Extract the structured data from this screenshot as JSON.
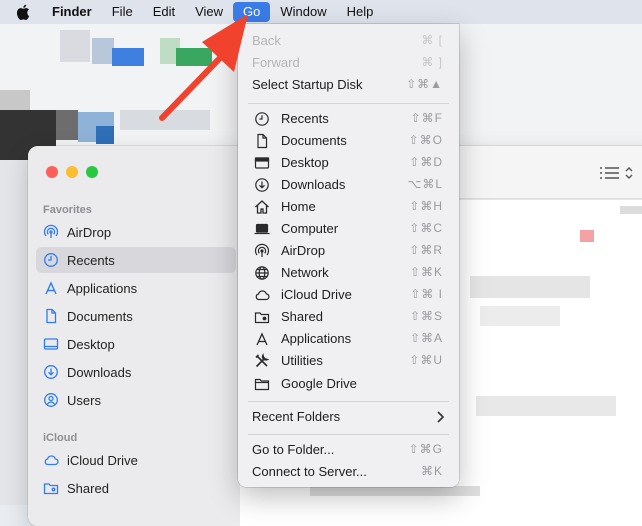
{
  "menubar": {
    "items": [
      {
        "label": "Finder"
      },
      {
        "label": "File"
      },
      {
        "label": "Edit"
      },
      {
        "label": "View"
      },
      {
        "label": "Go"
      },
      {
        "label": "Window"
      },
      {
        "label": "Help"
      }
    ]
  },
  "go_menu": {
    "nav": [
      {
        "label": "Back",
        "shortcut": "⌘ [",
        "disabled": true
      },
      {
        "label": "Forward",
        "shortcut": "⌘ ]",
        "disabled": true
      },
      {
        "label": "Select Startup Disk",
        "shortcut": "⇧⌘▲"
      }
    ],
    "places": [
      {
        "label": "Recents",
        "shortcut": "⇧⌘F",
        "icon": "clock-icon"
      },
      {
        "label": "Documents",
        "shortcut": "⇧⌘O",
        "icon": "document-icon"
      },
      {
        "label": "Desktop",
        "shortcut": "⇧⌘D",
        "icon": "desktop-icon"
      },
      {
        "label": "Downloads",
        "shortcut": "⌥⌘L",
        "icon": "download-icon"
      },
      {
        "label": "Home",
        "shortcut": "⇧⌘H",
        "icon": "home-icon"
      },
      {
        "label": "Computer",
        "shortcut": "⇧⌘C",
        "icon": "laptop-icon"
      },
      {
        "label": "AirDrop",
        "shortcut": "⇧⌘R",
        "icon": "airdrop-icon"
      },
      {
        "label": "Network",
        "shortcut": "⇧⌘K",
        "icon": "globe-icon"
      },
      {
        "label": "iCloud Drive",
        "shortcut": "⇧⌘ I",
        "icon": "cloud-icon"
      },
      {
        "label": "Shared",
        "shortcut": "⇧⌘S",
        "icon": "shared-folder-icon"
      },
      {
        "label": "Applications",
        "shortcut": "⇧⌘A",
        "icon": "applications-icon"
      },
      {
        "label": "Utilities",
        "shortcut": "⇧⌘U",
        "icon": "utilities-icon"
      },
      {
        "label": "Google Drive",
        "shortcut": "",
        "icon": "folder-icon"
      }
    ],
    "recent_folders": {
      "label": "Recent Folders"
    },
    "go_to_folder": {
      "label": "Go to Folder...",
      "shortcut": "⇧⌘G"
    },
    "connect_to_server": {
      "label": "Connect to Server...",
      "shortcut": "⌘K"
    }
  },
  "sidebar": {
    "favorites_heading": "Favorites",
    "favorites": [
      {
        "label": "AirDrop",
        "icon": "airdrop-icon"
      },
      {
        "label": "Recents",
        "icon": "clock-icon",
        "selected": true
      },
      {
        "label": "Applications",
        "icon": "applications-icon"
      },
      {
        "label": "Documents",
        "icon": "document-icon"
      },
      {
        "label": "Desktop",
        "icon": "desktop-icon"
      },
      {
        "label": "Downloads",
        "icon": "download-icon"
      },
      {
        "label": "Users",
        "icon": "user-icon"
      }
    ],
    "icloud_heading": "iCloud",
    "icloud": [
      {
        "label": "iCloud Drive",
        "icon": "cloud-icon"
      },
      {
        "label": "Shared",
        "icon": "shared-folder-icon"
      }
    ]
  },
  "colors": {
    "accent": "#3b7ce8",
    "arrow": "#f0422d",
    "sidebar_icon": "#2f7cf6"
  }
}
